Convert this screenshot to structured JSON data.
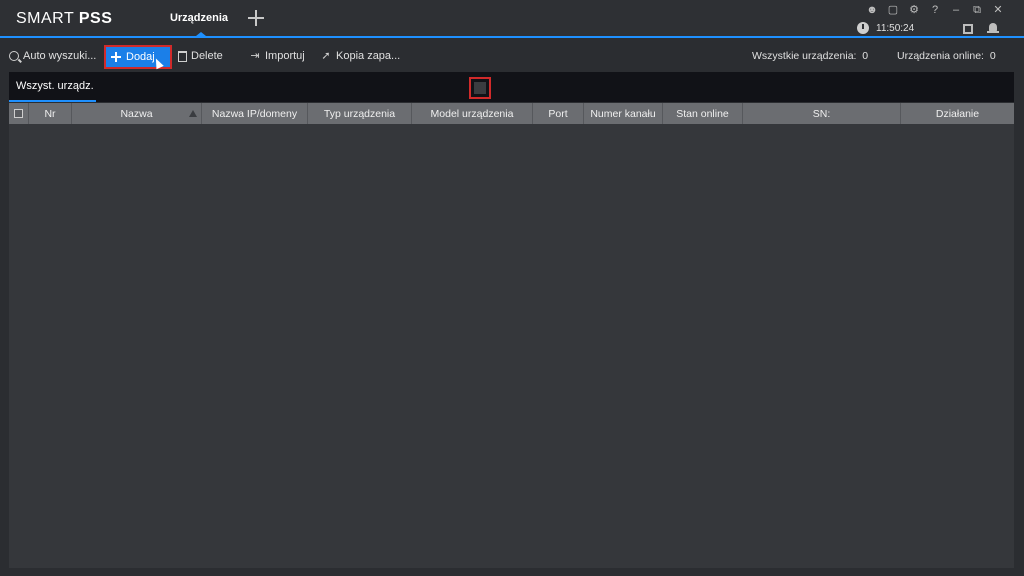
{
  "app": {
    "logo_regular": "SMART ",
    "logo_bold": "PSS"
  },
  "tabs": {
    "main": "Urządzenia"
  },
  "system": {
    "time": "11:50:24",
    "help": "?",
    "icons": [
      "user-icon",
      "lock-icon",
      "settings-icon",
      "help-icon",
      "minimize-icon",
      "restore-icon",
      "close-icon"
    ]
  },
  "toolbar": {
    "auto_search": "Auto wyszuki...",
    "add": "Dodaj",
    "delete": "Delete",
    "import": "Importuj",
    "backup": "Kopia zapa..."
  },
  "stats": {
    "all_label": "Wszystkie urządzenia:",
    "all_value": "0",
    "online_label": "Urządzenia online:",
    "online_value": "0"
  },
  "subtab": {
    "all": "Wszyst. urządz."
  },
  "table": {
    "columns": [
      "Nr",
      "Nazwa",
      "Nazwa IP/domeny",
      "Typ urządzenia",
      "Model urządzenia",
      "Port",
      "Numer kanału",
      "Stan online",
      "SN:",
      "Działanie"
    ],
    "rows": []
  },
  "colors": {
    "accent": "#1e90ff",
    "add_button": "#1b7fe8",
    "highlight": "#d12a2a"
  }
}
